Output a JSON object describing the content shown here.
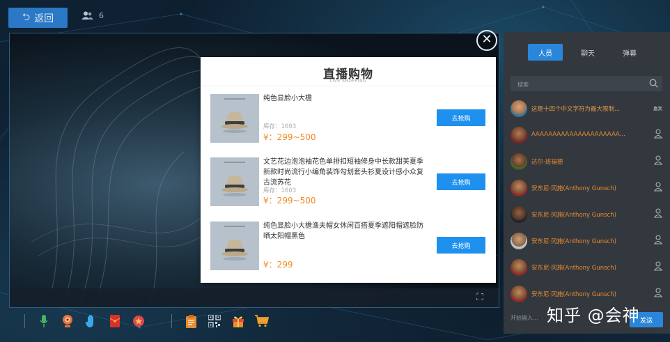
{
  "header": {
    "back_label": "返回",
    "viewer_count": "6"
  },
  "modal": {
    "title": "直播购物",
    "subtitle": "LIVE SHOPPING",
    "items": [
      {
        "name": "纯色显脸小大檐",
        "stock": "库存：1603",
        "price": "¥：299~500",
        "buy_label": "去抢购"
      },
      {
        "name": "文艺花边泡泡袖花色单排扣短袖修身中长款甜美夏季新款时尚流行小编角装饰勾划套头衫夏设计感小众复古流苏花",
        "stock": "库存：1603",
        "price": "¥：299~500",
        "buy_label": "去抢购"
      },
      {
        "name": "纯色显脸小大檐渔夫帽女休闲百搭夏季遮阳帽遮脸防晒太阳帽黑色",
        "stock": "库存：1603",
        "price": "¥：299",
        "buy_label": "去抢购"
      }
    ]
  },
  "panel": {
    "tabs": [
      "人员",
      "聊天",
      "弹幕"
    ],
    "search_placeholder": "搜索",
    "users": [
      {
        "name": "这是十四个中文字符为最大限制...",
        "badge": "嘉宾"
      },
      {
        "name": "AAAAAAAAAAAAAAAAAAAAA...",
        "badge": ""
      },
      {
        "name": "达尔·班福德",
        "badge": ""
      },
      {
        "name": "安东尼·冈施(Anthony Gunsch)",
        "badge": ""
      },
      {
        "name": "安东尼·冈施(Anthony Gunsch)",
        "badge": ""
      },
      {
        "name": "安东尼·冈施(Anthony Gunsch)",
        "badge": ""
      },
      {
        "name": "安东尼·冈施(Anthony Gunsch)",
        "badge": ""
      },
      {
        "name": "安东尼·冈施(Anthony Gunsch)",
        "badge": ""
      }
    ],
    "chat_placeholder": "开始输入...",
    "send_label": "发送"
  },
  "watermark": "知乎 @会神",
  "colors": {
    "accent": "#2a86da",
    "price": "#f28b20",
    "username": "#e88a2e"
  },
  "toolbar_icons": [
    "microphone-icon",
    "webcam-icon",
    "raise-hand-icon",
    "red-envelope-icon",
    "reward-icon",
    "clipboard-icon",
    "qrcode-icon",
    "gift-icon",
    "cart-icon"
  ]
}
